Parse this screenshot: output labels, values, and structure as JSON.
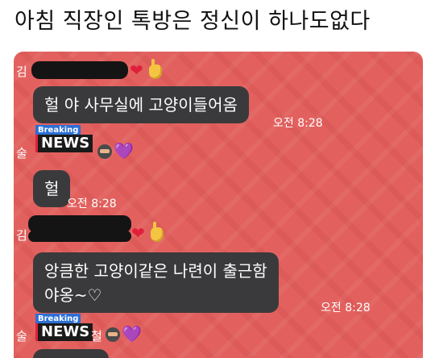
{
  "post": {
    "title": "아침 직장인 톡방은 정신이 하나도없다"
  },
  "chat": {
    "messages": [
      {
        "sender_visible": "김",
        "sender_suffix": "",
        "text": "헐 야 사무실에 고양이들어옴",
        "time": "오전 8:28"
      },
      {
        "sender_visible": "술",
        "badge": {
          "top": "Breaking",
          "word": "NEWS"
        },
        "text": "헐",
        "time": "오전 8:28"
      },
      {
        "sender_visible": "김",
        "line1": "앙큼한 고양이같은 나련이 출근함",
        "line2": "야옹~♡",
        "time": "오전 8:28"
      },
      {
        "sender_visible": "술",
        "sender_suffix": "철",
        "badge": {
          "top": "Breaking",
          "word": "NEWS"
        }
      }
    ],
    "icons": {
      "heart": "red-heart-icon",
      "hand": "crossed-fingers-icon",
      "ninja": "ninja-icon",
      "purple_heart": "purple-heart-icon"
    },
    "colors": {
      "background": "#e2615e",
      "bubble": "#3a3a3c",
      "breaking_badge": "#2b6fd6"
    },
    "glyphs": {
      "heart": "❤",
      "purple_heart": "💜"
    }
  }
}
